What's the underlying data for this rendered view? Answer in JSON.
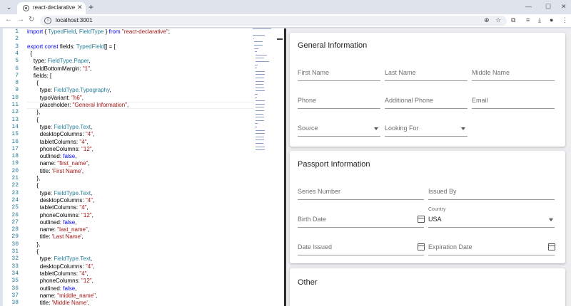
{
  "browser": {
    "tab_title": "react-declarative",
    "tab_close": "✕",
    "new_tab": "+",
    "url": "localhost:3001"
  },
  "editor": {
    "lines": [
      [
        [
          "kw",
          "import"
        ],
        [
          "pn",
          " { "
        ],
        [
          "ty",
          "TypedField"
        ],
        [
          "pn",
          ", "
        ],
        [
          "ty",
          "FieldType"
        ],
        [
          "pn",
          " } "
        ],
        [
          "kw",
          "from"
        ],
        [
          "pn",
          " "
        ],
        [
          "str",
          "\"react-declarative\""
        ],
        [
          "pn",
          ";"
        ]
      ],
      [],
      [
        [
          "kw",
          "export"
        ],
        [
          "pn",
          " "
        ],
        [
          "kw",
          "const"
        ],
        [
          "pn",
          " fields: "
        ],
        [
          "ty",
          "TypedField"
        ],
        [
          "pn",
          "[] = ["
        ]
      ],
      [
        [
          "pn",
          "  {"
        ]
      ],
      [
        [
          "pn",
          "    type: "
        ],
        [
          "ty",
          "FieldType.Paper"
        ],
        [
          "pn",
          ","
        ]
      ],
      [
        [
          "pn",
          "    fieldBottomMargin: "
        ],
        [
          "str",
          "\"1\""
        ],
        [
          "pn",
          ","
        ]
      ],
      [
        [
          "pn",
          "    fields: ["
        ]
      ],
      [
        [
          "pn",
          "      {"
        ]
      ],
      [
        [
          "pn",
          "        type: "
        ],
        [
          "ty",
          "FieldType.Typography"
        ],
        [
          "pn",
          ","
        ]
      ],
      [
        [
          "pn",
          "        typoVariant: "
        ],
        [
          "str",
          "\"h6\""
        ],
        [
          "pn",
          ","
        ]
      ],
      [
        [
          "pn",
          "        placeholder: "
        ],
        [
          "str",
          "\"General Information\""
        ],
        [
          "pn",
          ","
        ]
      ],
      [
        [
          "pn",
          "      },"
        ]
      ],
      [
        [
          "pn",
          "      {"
        ]
      ],
      [
        [
          "pn",
          "        type: "
        ],
        [
          "ty",
          "FieldType.Text"
        ],
        [
          "pn",
          ","
        ]
      ],
      [
        [
          "pn",
          "        desktopColumns: "
        ],
        [
          "str",
          "\"4\""
        ],
        [
          "pn",
          ","
        ]
      ],
      [
        [
          "pn",
          "        tabletColumns: "
        ],
        [
          "str",
          "\"4\""
        ],
        [
          "pn",
          ","
        ]
      ],
      [
        [
          "pn",
          "        phoneColumns: "
        ],
        [
          "str",
          "\"12\""
        ],
        [
          "pn",
          ","
        ]
      ],
      [
        [
          "pn",
          "        outlined: "
        ],
        [
          "kw",
          "false"
        ],
        [
          "pn",
          ","
        ]
      ],
      [
        [
          "pn",
          "        name: "
        ],
        [
          "str",
          "\"first_name\""
        ],
        [
          "pn",
          ","
        ]
      ],
      [
        [
          "pn",
          "        title: "
        ],
        [
          "str",
          "'First Name'"
        ],
        [
          "pn",
          ","
        ]
      ],
      [
        [
          "pn",
          "      },"
        ]
      ],
      [
        [
          "pn",
          "      {"
        ]
      ],
      [
        [
          "pn",
          "        type: "
        ],
        [
          "ty",
          "FieldType.Text"
        ],
        [
          "pn",
          ","
        ]
      ],
      [
        [
          "pn",
          "        desktopColumns: "
        ],
        [
          "str",
          "\"4\""
        ],
        [
          "pn",
          ","
        ]
      ],
      [
        [
          "pn",
          "        tabletColumns: "
        ],
        [
          "str",
          "\"4\""
        ],
        [
          "pn",
          ","
        ]
      ],
      [
        [
          "pn",
          "        phoneColumns: "
        ],
        [
          "str",
          "\"12\""
        ],
        [
          "pn",
          ","
        ]
      ],
      [
        [
          "pn",
          "        outlined: "
        ],
        [
          "kw",
          "false"
        ],
        [
          "pn",
          ","
        ]
      ],
      [
        [
          "pn",
          "        name: "
        ],
        [
          "str",
          "\"last_name\""
        ],
        [
          "pn",
          ","
        ]
      ],
      [
        [
          "pn",
          "        title: "
        ],
        [
          "str",
          "'Last Name'"
        ],
        [
          "pn",
          ","
        ]
      ],
      [
        [
          "pn",
          "      },"
        ]
      ],
      [
        [
          "pn",
          "      {"
        ]
      ],
      [
        [
          "pn",
          "        type: "
        ],
        [
          "ty",
          "FieldType.Text"
        ],
        [
          "pn",
          ","
        ]
      ],
      [
        [
          "pn",
          "        desktopColumns: "
        ],
        [
          "str",
          "\"4\""
        ],
        [
          "pn",
          ","
        ]
      ],
      [
        [
          "pn",
          "        tabletColumns: "
        ],
        [
          "str",
          "\"4\""
        ],
        [
          "pn",
          ","
        ]
      ],
      [
        [
          "pn",
          "        phoneColumns: "
        ],
        [
          "str",
          "\"12\""
        ],
        [
          "pn",
          ","
        ]
      ],
      [
        [
          "pn",
          "        outlined: "
        ],
        [
          "kw",
          "false"
        ],
        [
          "pn",
          ","
        ]
      ],
      [
        [
          "pn",
          "        name: "
        ],
        [
          "str",
          "\"middle_name\""
        ],
        [
          "pn",
          ","
        ]
      ],
      [
        [
          "pn",
          "        title: "
        ],
        [
          "str",
          "'Middle Name'"
        ],
        [
          "pn",
          ","
        ]
      ]
    ]
  },
  "form": {
    "general": {
      "title": "General Information",
      "first_name": "First Name",
      "last_name": "Last Name",
      "middle_name": "Middle Name",
      "phone": "Phone",
      "additional_phone": "Additional Phone",
      "email": "Email",
      "source": "Source",
      "looking_for": "Looking For"
    },
    "passport": {
      "title": "Passport Information",
      "series_number": "Series Number",
      "issued_by": "Issued By",
      "birth_date": "Birth Date",
      "country_label": "Country",
      "country_value": "USA",
      "date_issued": "Date Issued",
      "expiration_date": "Expiration Date"
    },
    "other": {
      "title": "Other"
    }
  }
}
